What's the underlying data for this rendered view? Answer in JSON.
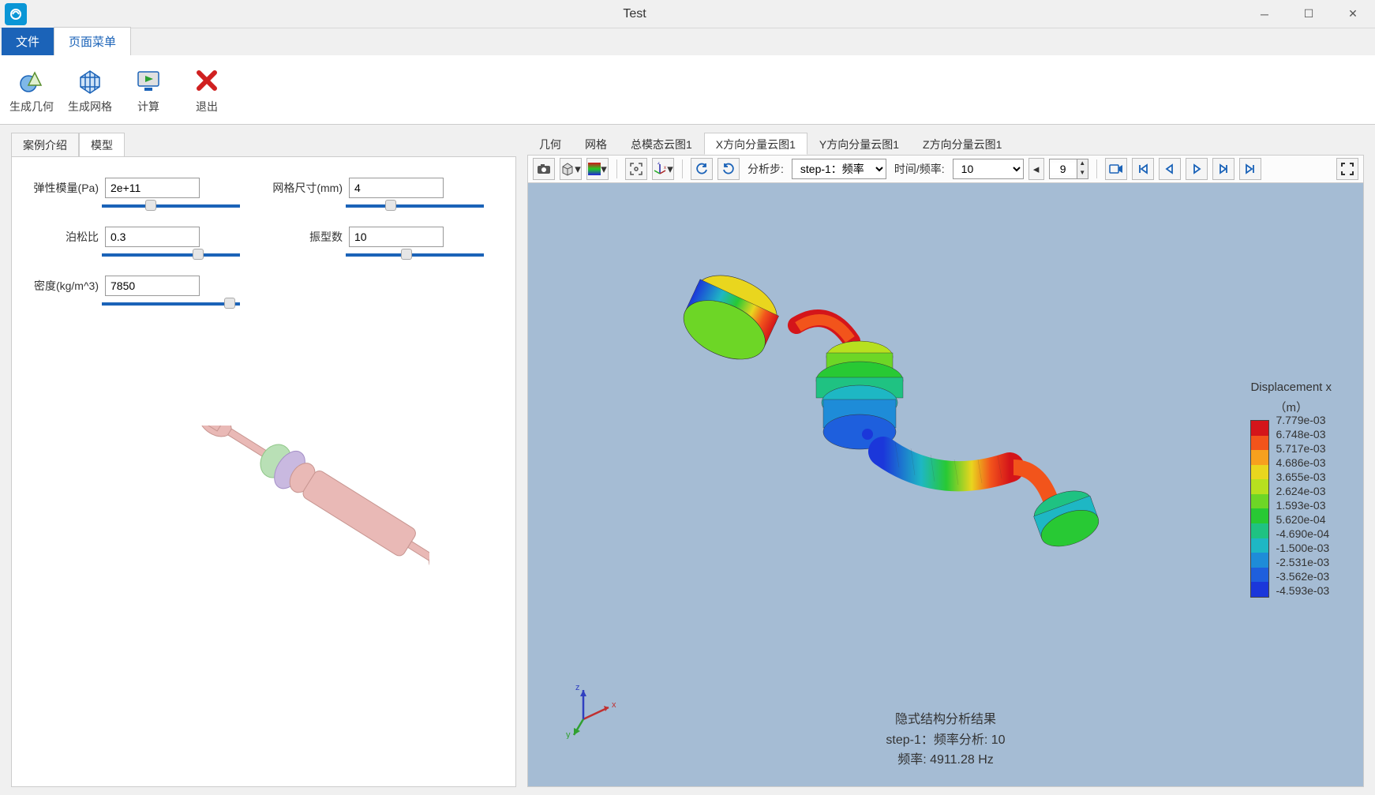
{
  "window": {
    "title": "Test"
  },
  "ribbon": {
    "file": "文件",
    "page_menu": "页面菜单"
  },
  "toolbar": {
    "gen_geometry": "生成几何",
    "gen_mesh": "生成网格",
    "compute": "计算",
    "exit": "退出"
  },
  "left_tabs": {
    "intro": "案例介绍",
    "model": "模型"
  },
  "params": {
    "elastic_modulus_label": "弹性模量(Pa)",
    "elastic_modulus_value": "2e+11",
    "mesh_size_label": "网格尺寸(mm)",
    "mesh_size_value": "4",
    "poisson_label": "泊松比",
    "poisson_value": "0.3",
    "modes_label": "振型数",
    "modes_value": "10",
    "density_label": "密度(kg/m^3)",
    "density_value": "7850"
  },
  "right_tabs": {
    "geometry": "几何",
    "mesh": "网格",
    "total": "总模态云图1",
    "x": "X方向分量云图1",
    "y": "Y方向分量云图1",
    "z": "Z方向分量云图1"
  },
  "viz_bar": {
    "step_label": "分析步:",
    "step_value": "step-1：频率",
    "time_label": "时间/频率:",
    "time_value": "10",
    "spin_value": "9"
  },
  "legend": {
    "title1": "Displacement x",
    "title2": "（m）",
    "values": [
      "7.779e-03",
      "6.748e-03",
      "5.717e-03",
      "4.686e-03",
      "3.655e-03",
      "2.624e-03",
      "1.593e-03",
      "5.620e-04",
      "-4.690e-04",
      "-1.500e-03",
      "-2.531e-03",
      "-3.562e-03",
      "-4.593e-03"
    ],
    "colors": [
      "#d4151a",
      "#f2541b",
      "#f7a01e",
      "#e9d61e",
      "#b7e01f",
      "#6dd626",
      "#28c934",
      "#1fc282",
      "#1eb7c4",
      "#1e8cd8",
      "#1e5fdd",
      "#1b37da"
    ]
  },
  "result": {
    "line1": "隐式结构分析结果",
    "line2": "step-1：频率分析: 10",
    "line3": "频率:   4911.28 Hz"
  }
}
